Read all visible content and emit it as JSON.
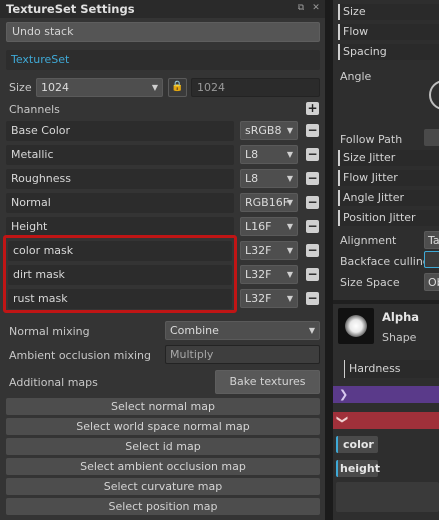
{
  "left_panel": {
    "title": "TextureSet Settings",
    "undo_stack": "Undo stack",
    "textureset_label": "TextureSet",
    "size": {
      "label": "Size",
      "value": "1024",
      "linked_value": "1024"
    },
    "channels": {
      "label": "Channels",
      "items": [
        {
          "name": "Base Color",
          "format": "sRGB8"
        },
        {
          "name": "Metallic",
          "format": "L8"
        },
        {
          "name": "Roughness",
          "format": "L8"
        },
        {
          "name": "Normal",
          "format": "RGB16F"
        },
        {
          "name": "Height",
          "format": "L16F"
        },
        {
          "name": "color mask",
          "format": "L32F"
        },
        {
          "name": "dirt mask",
          "format": "L32F"
        },
        {
          "name": "rust mask",
          "format": "L32F"
        }
      ]
    },
    "normal_mixing": {
      "label": "Normal mixing",
      "value": "Combine"
    },
    "ao_mixing": {
      "label": "Ambient occlusion mixing",
      "value": "Multiply"
    },
    "additional_maps": {
      "label": "Additional maps",
      "bake_button": "Bake textures"
    },
    "select_maps": [
      "Select normal map",
      "Select world space normal map",
      "Select id map",
      "Select ambient occlusion map",
      "Select curvature map",
      "Select position map"
    ]
  },
  "right_panel": {
    "size": "Size",
    "flow": "Flow",
    "spacing": "Spacing",
    "angle": "Angle",
    "follow_path": "Follow Path",
    "size_jitter": "Size Jitter",
    "flow_jitter": "Flow Jitter",
    "angle_jitter": "Angle Jitter",
    "position_jitter": "Position Jitter",
    "alignment": {
      "label": "Alignment",
      "value": "Ta"
    },
    "backface_culling": "Backface culling",
    "size_space": {
      "label": "Size Space",
      "value": "Ob"
    },
    "alpha": {
      "title": "Alpha",
      "subtitle": "Shape"
    },
    "hardness": "Hardness",
    "tags": [
      "color",
      "height"
    ]
  },
  "colors": {
    "highlight_red": "#c01515",
    "accent_cyan": "#3fa9d6",
    "purple_bar": "#5a3a8a",
    "red_bar": "#a0303a"
  }
}
